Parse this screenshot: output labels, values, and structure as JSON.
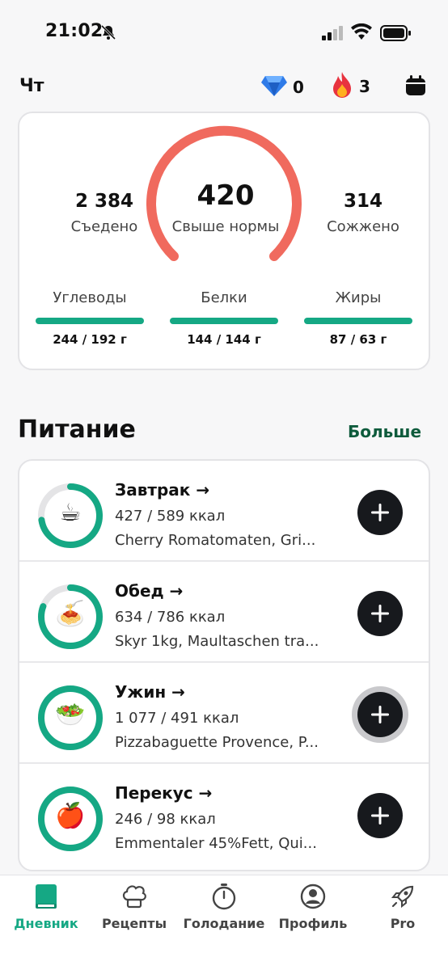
{
  "status_bar": {
    "time": "21:02"
  },
  "top_bar": {
    "day": "Чт",
    "gems": "0",
    "streak": "3"
  },
  "summary": {
    "eaten_value": "2 384",
    "eaten_label": "Съедено",
    "over_value": "420",
    "over_label": "Свыше нормы",
    "burned_value": "314",
    "burned_label": "Сожжено",
    "macros": [
      {
        "label": "Углеводы",
        "value": "244 / 192 г",
        "progress": 1.0
      },
      {
        "label": "Белки",
        "value": "144 / 144 г",
        "progress": 1.0
      },
      {
        "label": "Жиры",
        "value": "87 / 63 г",
        "progress": 1.0
      }
    ]
  },
  "nutrition": {
    "title": "Питание",
    "more": "Больше",
    "meals": [
      {
        "name": "Завтрак",
        "arrow": "→",
        "kcal": "427 / 589 ккал",
        "items": "Cherry Romatomaten, Gri...",
        "progress": 0.725,
        "icon": "coffee-icon"
      },
      {
        "name": "Обед",
        "arrow": "→",
        "kcal": "634 / 786 ккал",
        "items": "Skyr 1kg, Maultaschen tra...",
        "progress": 0.807,
        "icon": "pasta-icon"
      },
      {
        "name": "Ужин",
        "arrow": "→",
        "kcal": "1 077 / 491 ккал",
        "items": "Pizzabaguette Provence, P...",
        "progress": 1.0,
        "icon": "salad-icon"
      },
      {
        "name": "Перекус",
        "arrow": "→",
        "kcal": "246 / 98 ккал",
        "items": "Emmentaler 45%Fett, Qui...",
        "progress": 1.0,
        "icon": "apple-icon"
      }
    ]
  },
  "tabs": [
    {
      "label": "Дневник",
      "icon": "diary-icon",
      "active": true
    },
    {
      "label": "Рецепты",
      "icon": "chef-hat-icon",
      "active": false
    },
    {
      "label": "Голодание",
      "icon": "stopwatch-icon",
      "active": false
    },
    {
      "label": "Профиль",
      "icon": "profile-icon",
      "active": false
    },
    {
      "label": "Pro",
      "icon": "rocket-icon",
      "active": false
    }
  ],
  "colors": {
    "accent": "#15a884",
    "gauge": "#f06a5e",
    "dark_button": "#17191d",
    "link": "#0e5b3c"
  }
}
